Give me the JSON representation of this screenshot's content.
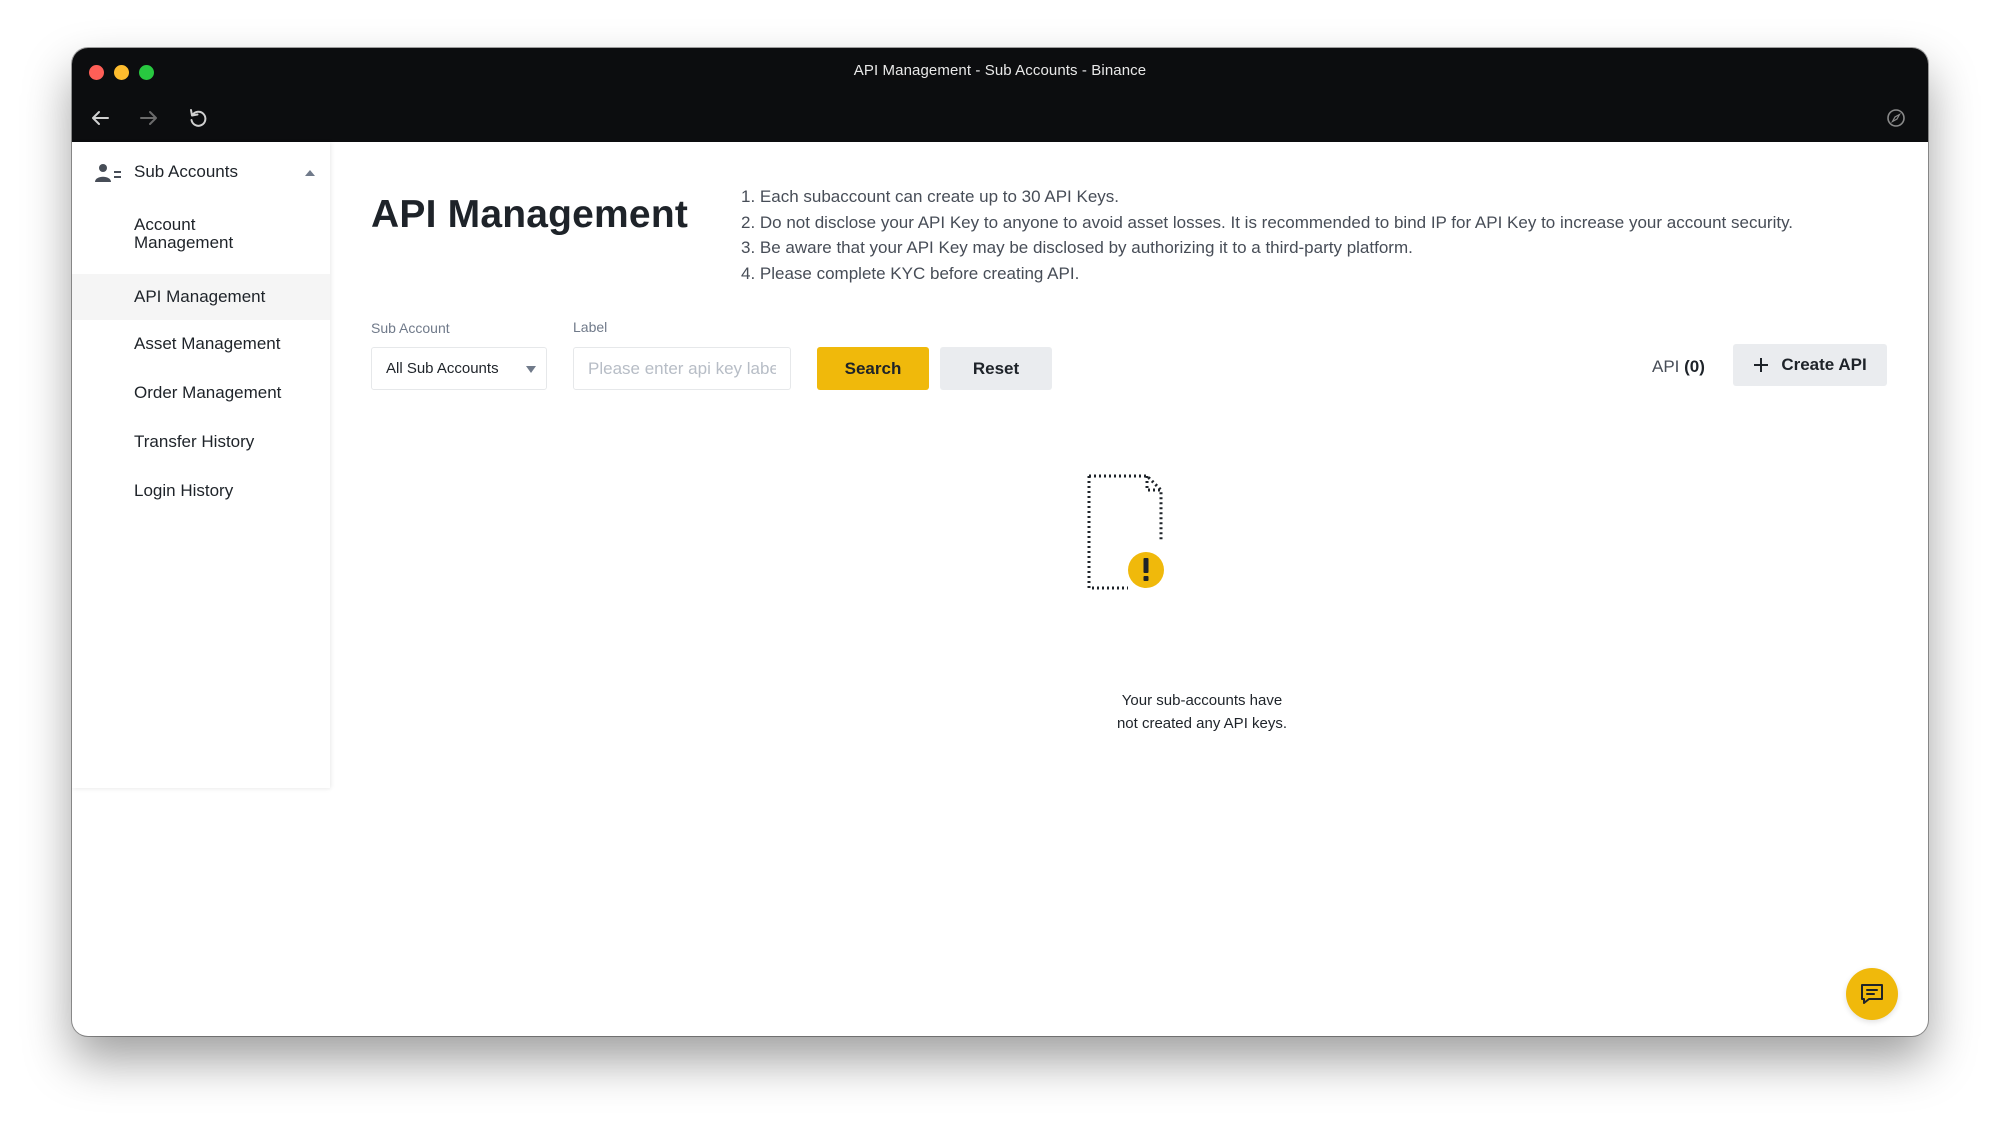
{
  "window": {
    "title": "API Management - Sub Accounts - Binance"
  },
  "sidebar": {
    "header": {
      "label": "Sub Accounts",
      "icon": "user-group-icon"
    },
    "items": [
      {
        "label": "Account Management",
        "active": false
      },
      {
        "label": "API Management",
        "active": true
      },
      {
        "label": "Asset Management",
        "active": false
      },
      {
        "label": "Order Management",
        "active": false
      },
      {
        "label": "Transfer History",
        "active": false
      },
      {
        "label": "Login History",
        "active": false
      }
    ]
  },
  "main": {
    "title": "API Management",
    "notes": [
      "1. Each subaccount can create up to 30 API Keys.",
      "2. Do not disclose your API Key to anyone to avoid asset losses. It is recommended to bind IP for API Key to increase your account security.",
      "3. Be aware that your API Key may be disclosed by authorizing it to a third-party platform.",
      "4. Please complete KYC before creating API."
    ],
    "filters": {
      "sub_account_label": "Sub Account",
      "sub_account_value": "All Sub Accounts",
      "label_label": "Label",
      "label_placeholder": "Please enter api key label"
    },
    "buttons": {
      "search": "Search",
      "reset": "Reset",
      "create": "Create API"
    },
    "api_count": {
      "prefix": "API ",
      "count": "(0)"
    },
    "empty_state": {
      "line1": "Your sub-accounts have",
      "line2": "not created any API keys."
    }
  },
  "colors": {
    "accent": "#f0b90b",
    "titlebar": "#0c0d0f",
    "text": "#1e2329",
    "muted": "#707a8a"
  }
}
